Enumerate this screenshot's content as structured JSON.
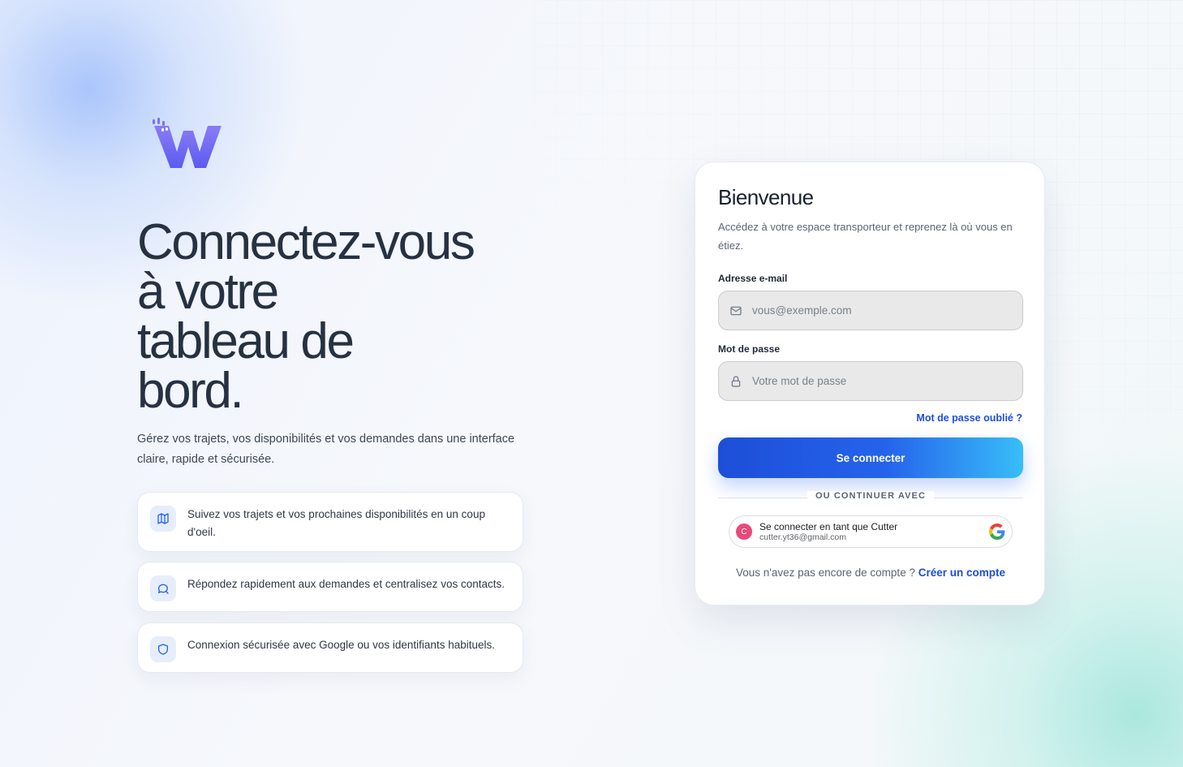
{
  "brand": {
    "logo_icon": "w-logo-icon",
    "accent": "#6366f1"
  },
  "hero": {
    "headline": "Connectez-vous\nà votre\ntableau de\nbord.",
    "subtitle": "Gérez vos trajets, vos disponibilités et vos demandes dans une interface claire, rapide et sécurisée."
  },
  "features": [
    {
      "icon": "map-icon",
      "text": "Suivez vos trajets et vos prochaines disponibilités en un coup d'oeil."
    },
    {
      "icon": "chat-icon",
      "text": "Répondez rapidement aux demandes et centralisez vos contacts."
    },
    {
      "icon": "shield-icon",
      "text": "Connexion sécurisée avec Google ou vos identifiants habituels."
    }
  ],
  "login": {
    "title": "Bienvenue",
    "description": "Accédez à votre espace transporteur et reprenez là où vous en étiez.",
    "email_label": "Adresse e-mail",
    "email_placeholder": "vous@exemple.com",
    "email_icon": "mail-icon",
    "password_label": "Mot de passe",
    "password_placeholder": "Votre mot de passe",
    "password_icon": "lock-icon",
    "forgot_label": "Mot de passe oublié ?",
    "submit_label": "Se connecter",
    "divider_label": "OU CONTINUER AVEC",
    "google": {
      "avatar_letter": "C",
      "name_line": "Se connecter en tant que Cutter",
      "email": "cutter.yt36@gmail.com",
      "icon": "google-icon"
    },
    "signup_prompt": "Vous n'avez pas encore de compte ?",
    "signup_link": "Créer un compte"
  },
  "colors": {
    "primary": "#1d4ed8",
    "button_gradient_end": "#38bdf8",
    "headline": "#263142"
  }
}
